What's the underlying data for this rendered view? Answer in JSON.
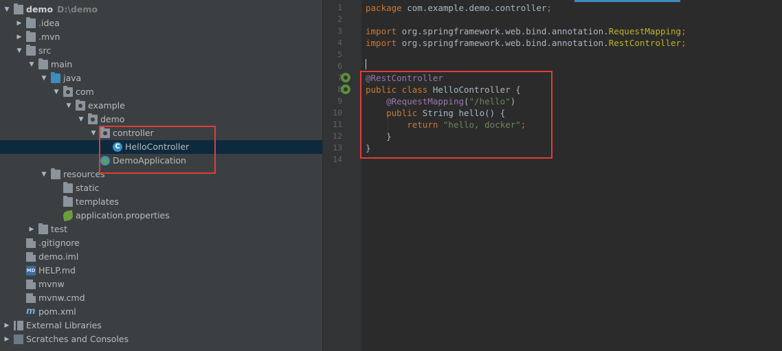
{
  "tree": {
    "rows": [
      {
        "label": "demo",
        "muted": "D:\\demo",
        "depth": 0,
        "arrow": "down",
        "icon": "folder-icon",
        "bold": true
      },
      {
        "label": ".idea",
        "depth": 1,
        "arrow": "right",
        "icon": "folder-icon"
      },
      {
        "label": ".mvn",
        "depth": 1,
        "arrow": "right",
        "icon": "folder-icon"
      },
      {
        "label": "src",
        "depth": 1,
        "arrow": "down",
        "icon": "folder-icon"
      },
      {
        "label": "main",
        "depth": 2,
        "arrow": "down",
        "icon": "folder-icon"
      },
      {
        "label": "java",
        "depth": 3,
        "arrow": "down",
        "icon": "source-folder-icon"
      },
      {
        "label": "com",
        "depth": 4,
        "arrow": "down",
        "icon": "package-icon"
      },
      {
        "label": "example",
        "depth": 5,
        "arrow": "down",
        "icon": "package-icon"
      },
      {
        "label": "demo",
        "depth": 6,
        "arrow": "down",
        "icon": "package-icon"
      },
      {
        "label": "controller",
        "depth": 7,
        "arrow": "down",
        "icon": "package-icon"
      },
      {
        "label": "HelloController",
        "depth": 8,
        "arrow": "",
        "icon": "class-icon",
        "selected": true
      },
      {
        "label": "DemoApplication",
        "depth": 7,
        "arrow": "",
        "icon": "spring-class-icon"
      },
      {
        "label": "resources",
        "depth": 3,
        "arrow": "down",
        "icon": "resources-folder-icon"
      },
      {
        "label": "static",
        "depth": 4,
        "arrow": "",
        "icon": "folder-icon"
      },
      {
        "label": "templates",
        "depth": 4,
        "arrow": "",
        "icon": "folder-icon"
      },
      {
        "label": "application.properties",
        "depth": 4,
        "arrow": "",
        "icon": "spring-properties-icon"
      },
      {
        "label": "test",
        "depth": 2,
        "arrow": "right",
        "icon": "folder-icon"
      },
      {
        "label": ".gitignore",
        "depth": 1,
        "arrow": "",
        "icon": "gitignore-icon"
      },
      {
        "label": "demo.iml",
        "depth": 1,
        "arrow": "",
        "icon": "iml-file-icon"
      },
      {
        "label": "HELP.md",
        "depth": 1,
        "arrow": "",
        "icon": "markdown-icon"
      },
      {
        "label": "mvnw",
        "depth": 1,
        "arrow": "",
        "icon": "file-icon"
      },
      {
        "label": "mvnw.cmd",
        "depth": 1,
        "arrow": "",
        "icon": "file-icon"
      },
      {
        "label": "pom.xml",
        "depth": 1,
        "arrow": "",
        "icon": "maven-icon"
      },
      {
        "label": "External Libraries",
        "depth": 0,
        "arrow": "right",
        "icon": "libraries-icon"
      },
      {
        "label": "Scratches and Consoles",
        "depth": 0,
        "arrow": "right",
        "icon": "scratches-icon"
      }
    ]
  },
  "editor": {
    "line_numbers": [
      "1",
      "2",
      "3",
      "4",
      "5",
      "6",
      "7",
      "8",
      "9",
      "10",
      "11",
      "12",
      "13",
      "14"
    ],
    "lines": [
      [
        {
          "t": "package ",
          "c": "kw"
        },
        {
          "t": "com.example.demo.controller",
          "c": ""
        },
        {
          "t": ";",
          "c": "kw"
        }
      ],
      [],
      [
        {
          "t": "import ",
          "c": "kw"
        },
        {
          "t": "org.springframework.web.bind.annotation.",
          "c": ""
        },
        {
          "t": "RequestMapping",
          "c": "ann"
        },
        {
          "t": ";",
          "c": "kw"
        }
      ],
      [
        {
          "t": "import ",
          "c": "kw"
        },
        {
          "t": "org.springframework.web.bind.annotation.",
          "c": ""
        },
        {
          "t": "RestController",
          "c": "ann"
        },
        {
          "t": ";",
          "c": "kw"
        }
      ],
      [],
      [],
      [
        {
          "t": "@RestController",
          "c": "cls"
        }
      ],
      [
        {
          "t": "public class ",
          "c": "kw"
        },
        {
          "t": "HelloController ",
          "c": ""
        },
        {
          "t": "{",
          "c": ""
        }
      ],
      [
        {
          "t": "    ",
          "c": ""
        },
        {
          "t": "@RequestMapping",
          "c": "cls"
        },
        {
          "t": "(",
          "c": ""
        },
        {
          "t": "\"/hello\"",
          "c": "str"
        },
        {
          "t": ")",
          "c": ""
        }
      ],
      [
        {
          "t": "    ",
          "c": ""
        },
        {
          "t": "public ",
          "c": "kw"
        },
        {
          "t": "String ",
          "c": ""
        },
        {
          "t": "hello",
          "c": ""
        },
        {
          "t": "() {",
          "c": ""
        }
      ],
      [
        {
          "t": "        ",
          "c": ""
        },
        {
          "t": "return ",
          "c": "kw"
        },
        {
          "t": "\"hello, docker\"",
          "c": "str"
        },
        {
          "t": ";",
          "c": "kw"
        }
      ],
      [
        {
          "t": "    }",
          "c": ""
        }
      ],
      [
        {
          "t": "}",
          "c": ""
        }
      ],
      []
    ],
    "gutter_icons": [
      {
        "line": 7,
        "name": "spring-bean-icon"
      },
      {
        "line": 8,
        "name": "spring-bean-run-icon"
      }
    ]
  }
}
